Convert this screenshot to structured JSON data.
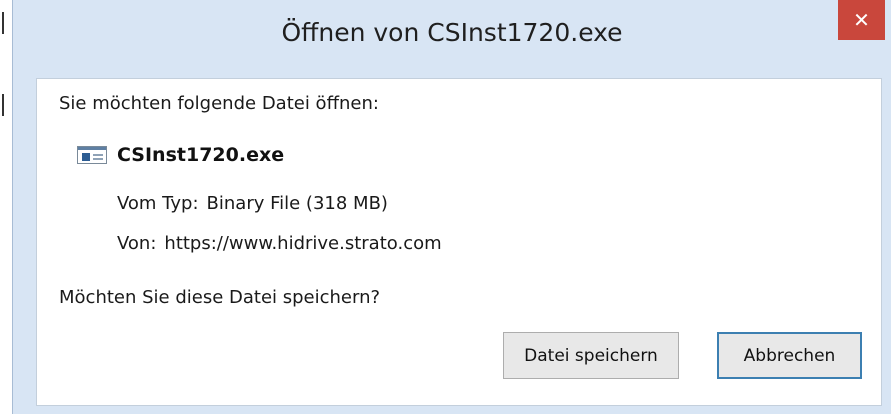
{
  "window": {
    "title": "Öffnen von CSInst1720.exe",
    "close_glyph": "✕",
    "close_color": "#c9473c"
  },
  "dialog": {
    "prompt": "Sie möchten folgende Datei öffnen:",
    "file_name": "CSInst1720.exe",
    "file_icon": "executable-file-icon",
    "type_label": "Vom Typ:",
    "type_value": "Binary File (318 MB)",
    "from_label": "Von:",
    "from_value": "https://www.hidrive.strato.com",
    "question": "Möchten Sie diese Datei speichern?"
  },
  "buttons": {
    "save_label": "Datei speichern",
    "cancel_label": "Abbrechen"
  }
}
